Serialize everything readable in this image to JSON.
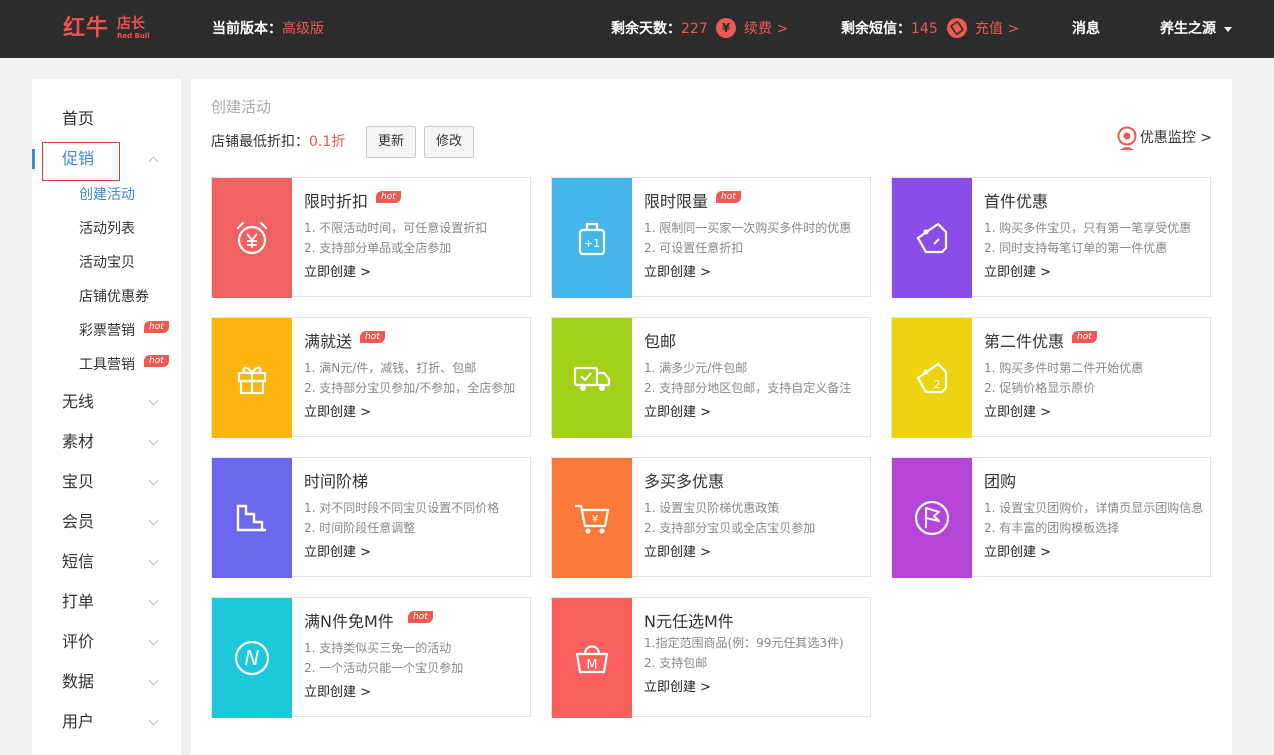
{
  "header": {
    "logo_text": "红牛",
    "logo_sub": "店长",
    "logo_en": "Red Bull",
    "version_label": "当前版本：",
    "version_value": "高级版",
    "days_label": "剩余天数：",
    "days_value": "227",
    "renew_icon": "¥",
    "renew_link": "续费 >",
    "sms_label": "剩余短信：",
    "sms_value": "145",
    "recharge_link": "充值 >",
    "messages": "消息",
    "user": "养生之源"
  },
  "sidebar": {
    "items": [
      {
        "label": "首页"
      },
      {
        "label": "促销"
      },
      {
        "label": "无线"
      },
      {
        "label": "素材"
      },
      {
        "label": "宝贝"
      },
      {
        "label": "会员"
      },
      {
        "label": "短信"
      },
      {
        "label": "打单"
      },
      {
        "label": "评价"
      },
      {
        "label": "数据"
      },
      {
        "label": "用户"
      }
    ],
    "sub_items": [
      {
        "label": "创建活动"
      },
      {
        "label": "活动列表"
      },
      {
        "label": "活动宝贝"
      },
      {
        "label": "店铺优惠券"
      },
      {
        "label": "彩票营销"
      },
      {
        "label": "工具营销"
      }
    ],
    "hot_label": "hot"
  },
  "main": {
    "page_title": "创建活动",
    "discount_label": "店铺最低折扣：",
    "discount_value": "0.1折",
    "update_button": "更新",
    "modify_button": "修改",
    "monitor_link": "优惠监控 >",
    "create_link": "立即创建 >",
    "hot_label": "hot",
    "cards": [
      {
        "title": "限时折扣",
        "desc1": "1. 不限活动时间，可任意设置折扣",
        "desc2": "2. 支持部分单品或全店参加",
        "color": "#f06261",
        "icon": "alarm-clock-yen-icon"
      },
      {
        "title": "限时限量",
        "desc1": "1. 限制同一买家一次购买多件时的优惠",
        "desc2": "2. 可设置任意折扣",
        "color": "#45b5ea",
        "icon": "shopping-bag-plus-one-icon"
      },
      {
        "title": "首件优惠",
        "desc1": "1. 购买多件宝贝，只有第一笔享受优惠",
        "desc2": "2. 同时支持每笔订单的第一件优惠",
        "color": "#8b4de8",
        "icon": "price-tag-icon"
      },
      {
        "title": "满就送",
        "desc1": "1. 满N元/件，减钱、打折、包邮",
        "desc2": "2. 支持部分宝贝参加/不参加，全店参加",
        "color": "#fcb50f",
        "icon": "gift-icon"
      },
      {
        "title": "包邮",
        "desc1": "1. 满多少元/件包邮",
        "desc2": "2. 支持部分地区包邮，支持自定义备注",
        "color": "#a3d018",
        "icon": "delivery-truck-icon"
      },
      {
        "title": "第二件优惠",
        "desc1": "1. 购买多件时第二件开始优惠",
        "desc2": "2. 促销价格显示原价",
        "color": "#eed410",
        "icon": "price-tag-two-icon"
      },
      {
        "title": "时间阶梯",
        "desc1": "1. 对不同时段不同宝贝设置不同价格",
        "desc2": "2. 时间阶段任意调整",
        "color": "#6b67ec",
        "icon": "stairs-icon"
      },
      {
        "title": "多买多优惠",
        "desc1": "1. 设置宝贝阶梯优惠政策",
        "desc2": "2. 支持部分宝贝或全店宝贝参加",
        "color": "#fb7a39",
        "icon": "shopping-cart-yen-icon"
      },
      {
        "title": "团购",
        "desc1": "1. 设置宝贝团购价，详情页显示团购信息",
        "desc2": "2. 有丰富的团购模板选择",
        "color": "#b544d8",
        "icon": "flag-icon"
      },
      {
        "title": "满N件免M件",
        "desc1": "1. 支持类似买三免一的活动",
        "desc2": "2. 一个活动只能一个宝贝参加",
        "color": "#1cc8da",
        "icon": "n-circle-icon"
      },
      {
        "title": "N元任选M件",
        "desc1": "1.指定范围商品(例：99元任其选3件)",
        "desc2": "2. 支持包邮",
        "color": "#fa5f5f",
        "icon": "basket-m-icon"
      }
    ]
  }
}
